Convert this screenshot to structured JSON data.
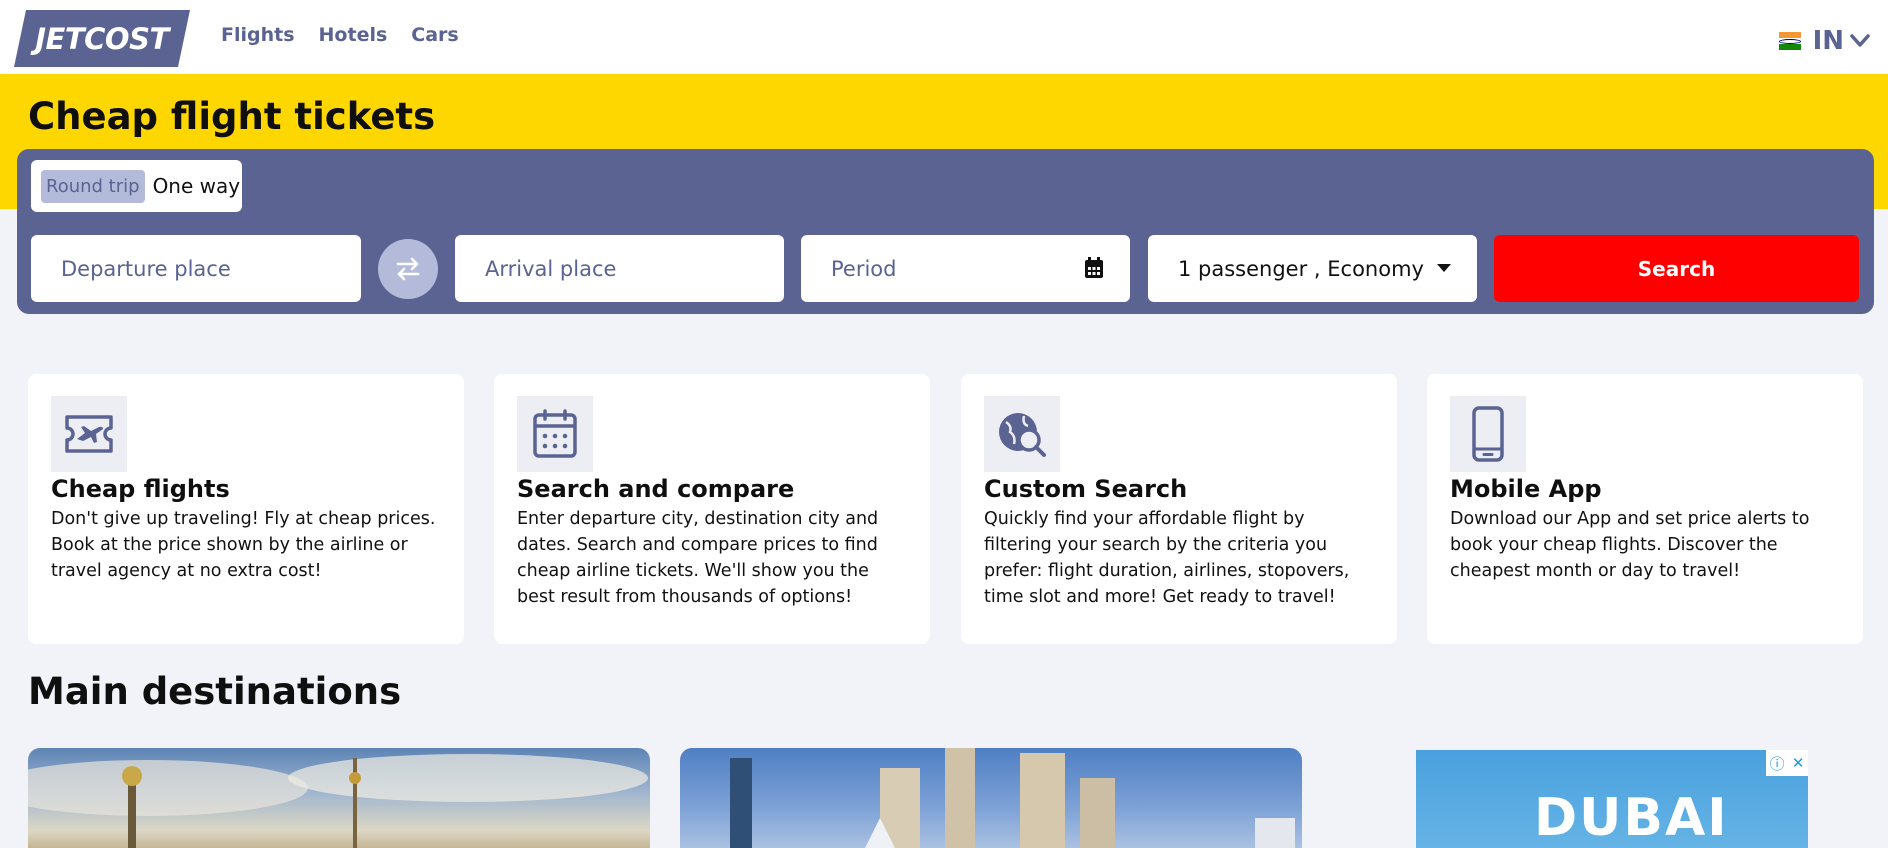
{
  "header": {
    "logo": "JETCOST",
    "nav": [
      "Flights",
      "Hotels",
      "Cars"
    ],
    "locale": "IN"
  },
  "hero": {
    "title": "Cheap flight tickets"
  },
  "search": {
    "trip_types": {
      "round": "Round trip",
      "one": "One way"
    },
    "departure_placeholder": "Departure place",
    "arrival_placeholder": "Arrival place",
    "period_placeholder": "Period",
    "passengers": "1 passenger , Economy",
    "search_label": "Search"
  },
  "features": [
    {
      "icon": "plane-ticket-icon",
      "title": "Cheap flights",
      "text": "Don't give up traveling! Fly at cheap prices. Book at the price shown by the airline or travel agency at no extra cost!"
    },
    {
      "icon": "calendar-icon",
      "title": "Search and compare",
      "text": "Enter departure city, destination city and dates. Search and compare prices to find cheap airline tickets. We'll show you the best result from thousands of options!"
    },
    {
      "icon": "globe-search-icon",
      "title": "Custom Search",
      "text": "Quickly find your affordable flight by filtering your search by the criteria you prefer: flight duration, airlines, stopovers, time slot and more! Get ready to travel!"
    },
    {
      "icon": "mobile-phone-icon",
      "title": "Mobile App",
      "text": "Download our App and set price alerts to book your cheap flights. Discover the cheapest month or day to travel!"
    }
  ],
  "destinations": {
    "title": "Main destinations"
  },
  "ad": {
    "text": "DUBAI"
  },
  "colors": {
    "brand": "#5a6391",
    "hero": "#fed701",
    "search_button": "#fe0000"
  }
}
